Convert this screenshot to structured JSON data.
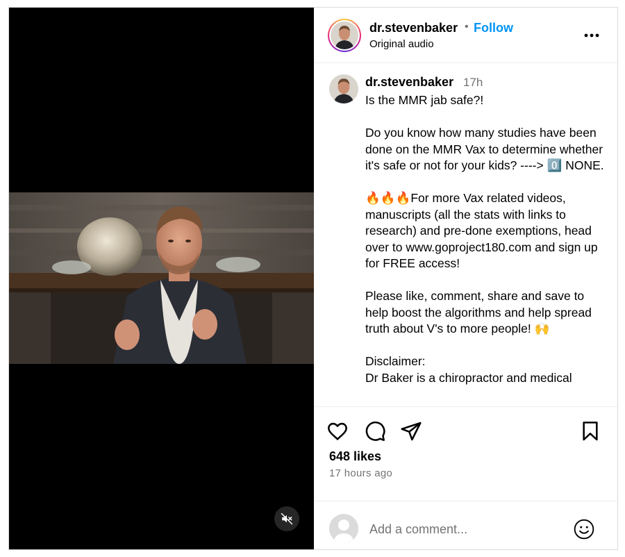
{
  "header": {
    "username": "dr.stevenbaker",
    "separator": "•",
    "follow_label": "Follow",
    "audio": "Original audio"
  },
  "caption": {
    "username": "dr.stevenbaker",
    "time": "17h",
    "text": "Is the MMR jab safe?!\n\nDo you know how many studies have been done on the MMR Vax to determine whether it's safe or not for your kids? ----> 0️⃣ NONE.\n\n🔥🔥🔥For more Vax related videos, manuscripts (all the stats with links to research) and pre-done exemptions, head over to www.goproject180.com and sign up for FREE access!\n\nPlease like, comment, share and save to help boost the algorithms and help spread truth about V's to more people! 🙌\n\nDisclaimer:\nDr Baker is a chiropractor and medical"
  },
  "stats": {
    "likes": "648 likes",
    "posted": "17 hours ago"
  },
  "comment": {
    "placeholder": "Add a comment..."
  },
  "icons": {
    "mute": "speaker-muted-icon",
    "more": "more-options-icon",
    "like": "heart-icon",
    "comment": "comment-icon",
    "share": "paper-plane-icon",
    "save": "bookmark-icon",
    "emoji": "smiley-icon"
  },
  "colors": {
    "accent": "#0095f6",
    "muted_text": "#737373",
    "border": "#dbdbdb"
  }
}
